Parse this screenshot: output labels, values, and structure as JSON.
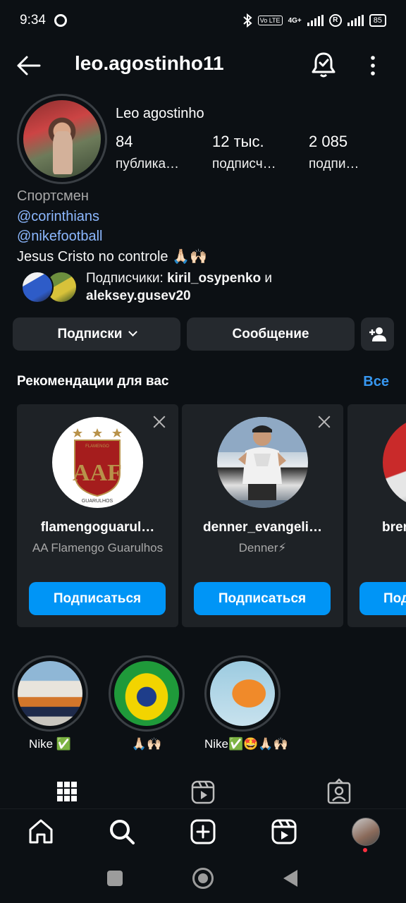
{
  "status_bar": {
    "time": "9:34",
    "network": "4G+",
    "volte": "Vo LTE",
    "battery": "85"
  },
  "header": {
    "username": "leo.agostinho11"
  },
  "profile": {
    "full_name": "Leo agostinho",
    "stats": [
      {
        "value": "84",
        "label": "публика…"
      },
      {
        "value": "12 тыс.",
        "label": "подписч…"
      },
      {
        "value": "2 085",
        "label": "подпи…"
      }
    ],
    "category": "Спортсмен",
    "mentions": [
      "@corinthians",
      "@nikefootball"
    ],
    "bio_text": "Jesus Cristo no controle 🙏🏻🙌🏻",
    "followed_by_prefix": "Подписчики: ",
    "followed_by_user1": "kiril_osypenko",
    "followed_by_and": " и",
    "followed_by_user2": "aleksey.gusev20"
  },
  "actions": {
    "following_label": "Подписки",
    "message_label": "Сообщение"
  },
  "suggestions": {
    "title": "Рекомендации для вас",
    "see_all": "Все",
    "cards": [
      {
        "username": "flamengoguarul…",
        "subtitle": "AA Flamengo Guarulhos",
        "button": "Подписаться",
        "logo_top": "FLAMENGO",
        "logo_mid": "AAF",
        "logo_bottom": "GUARULHOS"
      },
      {
        "username": "denner_evangeli…",
        "subtitle": "Denner⚡",
        "button": "Подписаться"
      },
      {
        "username": "bren",
        "subtitle": "",
        "button": "Под"
      }
    ]
  },
  "highlights": [
    {
      "label": "Nike ✅"
    },
    {
      "label": "🙏🏻🙌🏻"
    },
    {
      "label": "Nike✅🤩🙏🏻🙌🏻"
    }
  ],
  "colors": {
    "background": "#0c1014",
    "button_bg": "#25292e",
    "accent_blue": "#0095f6",
    "link_blue": "#3797f0",
    "card_bg": "#1e2226"
  }
}
